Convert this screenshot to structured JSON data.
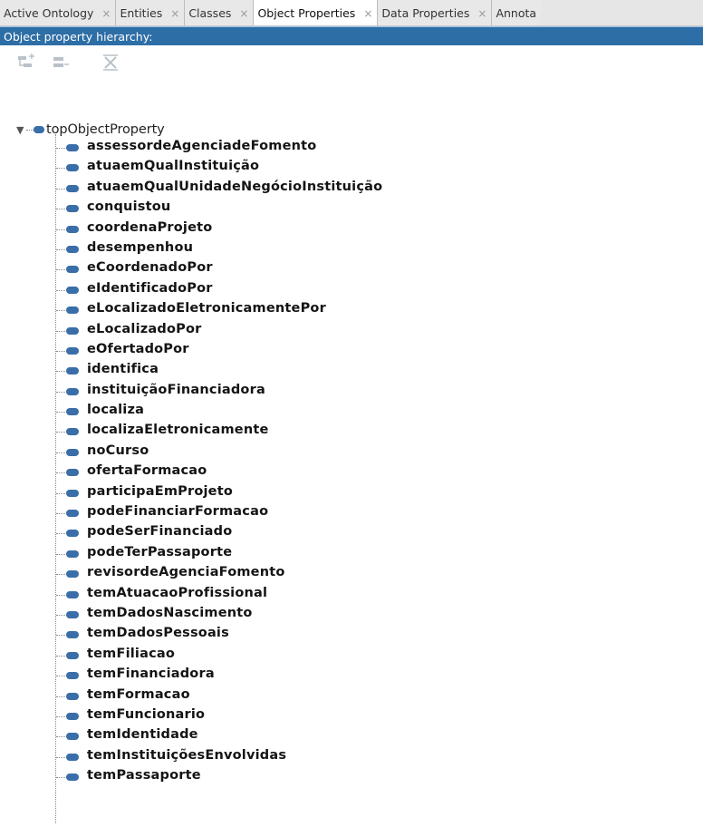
{
  "tabs": [
    {
      "label": "Active Ontology",
      "close": "×"
    },
    {
      "label": "Entities",
      "close": "×"
    },
    {
      "label": "Classes",
      "close": "×"
    },
    {
      "label": "Object Properties",
      "close": "×"
    },
    {
      "label": "Data Properties",
      "close": "×"
    },
    {
      "label": "Annota",
      "close": ""
    }
  ],
  "view": {
    "title": "Object property hierarchy:"
  },
  "tree": {
    "root": "topObjectProperty",
    "items": [
      "assessordeAgenciadeFomento",
      "atuaemQualInstituição",
      "atuaemQualUnidadeNegócioInstituição",
      "conquistou",
      "coordenaProjeto",
      "desempenhou",
      "eCoordenadoPor",
      "eIdentificadoPor",
      "eLocalizadoEletronicamentePor",
      "eLocalizadoPor",
      "eOfertadoPor",
      "identifica",
      "instituiçãoFinanciadora",
      "localiza",
      "localizaEletronicamente",
      "noCurso",
      "ofertaFormacao",
      "participaEmProjeto",
      "podeFinanciarFormacao",
      "podeSerFinanciado",
      "podeTerPassaporte",
      "revisordeAgenciaFomento",
      "temAtuacaoProfissional",
      "temDadosNascimento",
      "temDadosPessoais",
      "temFiliacao",
      "temFinanciadora",
      "temFormacao",
      "temFuncionario",
      "temIdentidade",
      "temInstituiçõesEnvolvidas",
      "temPassaporte"
    ]
  },
  "colors": {
    "header": "#2e6ea6",
    "property_icon": "#3a6ea8"
  }
}
